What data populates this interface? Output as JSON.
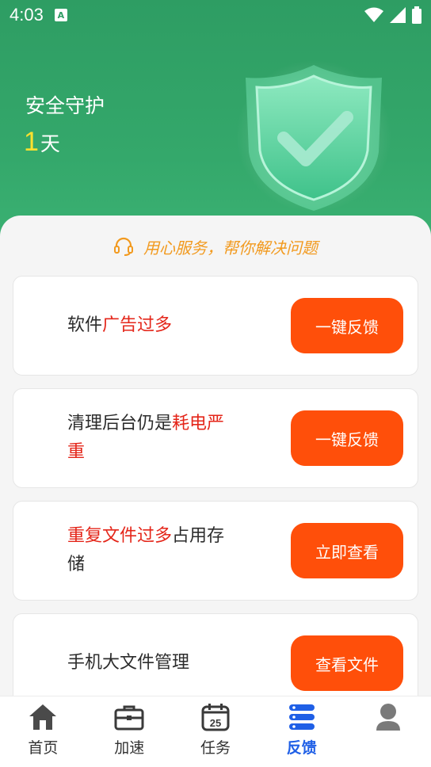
{
  "status_bar": {
    "time": "4:03",
    "a_badge": "A"
  },
  "header": {
    "title": "安全守护",
    "days_number": "1",
    "days_unit": "天"
  },
  "slogan": {
    "text": "用心服务，帮你解决问题",
    "icon": "headset-icon"
  },
  "cards": [
    {
      "pre": "软件",
      "highlight": "广告过多",
      "post": "",
      "button": "一键反馈"
    },
    {
      "pre": "清理后台仍是",
      "highlight": "耗电严重",
      "post": "",
      "button": "一键反馈"
    },
    {
      "pre": "",
      "highlight": "重复文件过多",
      "post": "占用存储",
      "button": "立即查看"
    },
    {
      "pre": "手机大文件管理",
      "highlight": "",
      "post": "",
      "button": "查看文件"
    }
  ],
  "tabs": [
    {
      "label": "首页",
      "icon": "home-icon"
    },
    {
      "label": "加速",
      "icon": "briefcase-icon"
    },
    {
      "label": "任务",
      "icon": "calendar-icon",
      "calendar_day": "25"
    },
    {
      "label": "反馈",
      "icon": "server-icon",
      "active": true
    },
    {
      "label": "",
      "icon": "user-icon"
    }
  ],
  "colors": {
    "header_green": "#2e9d63",
    "accent_orange": "#ff4f0a",
    "highlight_red": "#e4261a",
    "slogan_orange": "#f29a1f",
    "active_tab_blue": "#1f5fe6",
    "days_yellow": "#ffe12e"
  }
}
